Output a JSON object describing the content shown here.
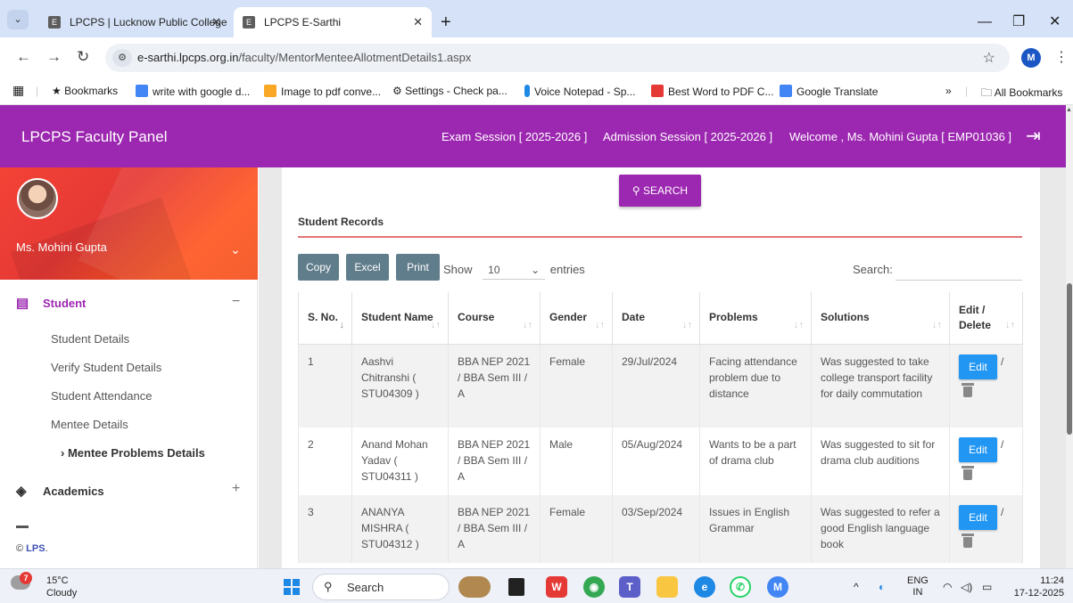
{
  "browser": {
    "tabs": [
      {
        "favicon": "E",
        "title": "LPCPS | Lucknow Public College",
        "active": false
      },
      {
        "favicon": "E",
        "title": "LPCPS E-Sarthi",
        "active": true
      }
    ],
    "new_tab": "+",
    "url_domain": "e-sarthi.lpcps.org.in",
    "url_path": "/faculty/MentorMenteeAllotmentDetails1.aspx",
    "profile_initial": "M",
    "bookmarks": [
      {
        "label": "Bookmarks",
        "icon": "star-icon",
        "color": "#222222"
      },
      {
        "label": "write with google d...",
        "icon": "docs-icon",
        "color": "#4285f4"
      },
      {
        "label": "Image to pdf conve...",
        "icon": "lines-icon",
        "color": "#f9a825"
      },
      {
        "label": "Settings - Check pa...",
        "icon": "gear-icon",
        "color": "#333333"
      },
      {
        "label": "Voice Notepad - Sp...",
        "icon": "mic-icon",
        "color": "#1e88e5"
      },
      {
        "label": "Best Word to PDF C...",
        "icon": "pdf-icon",
        "color": "#e53935"
      },
      {
        "label": "Google Translate",
        "icon": "translate-icon",
        "color": "#4285f4"
      }
    ],
    "bookmarks_overflow": "»",
    "all_bookmarks": "All Bookmarks"
  },
  "header": {
    "brand": "LPCPS Faculty Panel",
    "exam_session": "Exam Session [ 2025-2026 ]",
    "admission_session": "Admission Session [ 2025-2026 ]",
    "welcome": "Welcome , Ms. Mohini Gupta [ EMP01036 ]",
    "accent": "#9c27b0"
  },
  "sidebar": {
    "user_name": "Ms. Mohini Gupta",
    "menu": [
      {
        "label": "Student",
        "sign": "−",
        "color": "#9c27b0"
      },
      {
        "label": "Academics",
        "sign": "+",
        "color": "#333333"
      }
    ],
    "submenu": [
      "Student Details",
      "Verify Student Details",
      "Student Attendance",
      "Mentee Details"
    ],
    "active_submenu": "Mentee Problems Details",
    "footer_brand": "LPS",
    "footer_prefix": "©"
  },
  "main": {
    "search_label": "SEARCH",
    "records_title": "Student Records",
    "buttons": {
      "copy": "Copy",
      "excel": "Excel",
      "print": "Print"
    },
    "show_label": "Show",
    "entries_value": "10",
    "entries_label": "entries",
    "search_field_label": "Search:",
    "columns": [
      "S. No.",
      "Student Name",
      "Course",
      "Gender",
      "Date",
      "Problems",
      "Solutions",
      "Edit / Delete"
    ],
    "rows": [
      {
        "sno": "1",
        "name": "Aashvi Chitranshi ( STU04309 )",
        "course": "BBA NEP 2021 / BBA Sem III / A",
        "gender": "Female",
        "date": "29/Jul/2024",
        "problem": "Facing attendance problem due to distance",
        "solution": "Was suggested to take college transport facility for daily commutation",
        "edit": "Edit"
      },
      {
        "sno": "2",
        "name": "Anand Mohan Yadav ( STU04311 )",
        "course": "BBA NEP 2021 / BBA Sem III / A",
        "gender": "Male",
        "date": "05/Aug/2024",
        "problem": "Wants to be a part of drama club",
        "solution": "Was suggested to sit for drama club auditions",
        "edit": "Edit"
      },
      {
        "sno": "3",
        "name": "ANANYA MISHRA ( STU04312 )",
        "course": "BBA NEP 2021 / BBA Sem III / A",
        "gender": "Female",
        "date": "03/Sep/2024",
        "problem": "Issues in English Grammar",
        "solution": "Was suggested to refer a good English language book",
        "edit": "Edit"
      }
    ]
  },
  "taskbar": {
    "weather_badge": "7",
    "temperature": "15°C",
    "condition": "Cloudy",
    "search": "Search",
    "lang_top": "ENG",
    "lang_bottom": "IN",
    "time": "11:24",
    "date": "17-12-2025"
  }
}
